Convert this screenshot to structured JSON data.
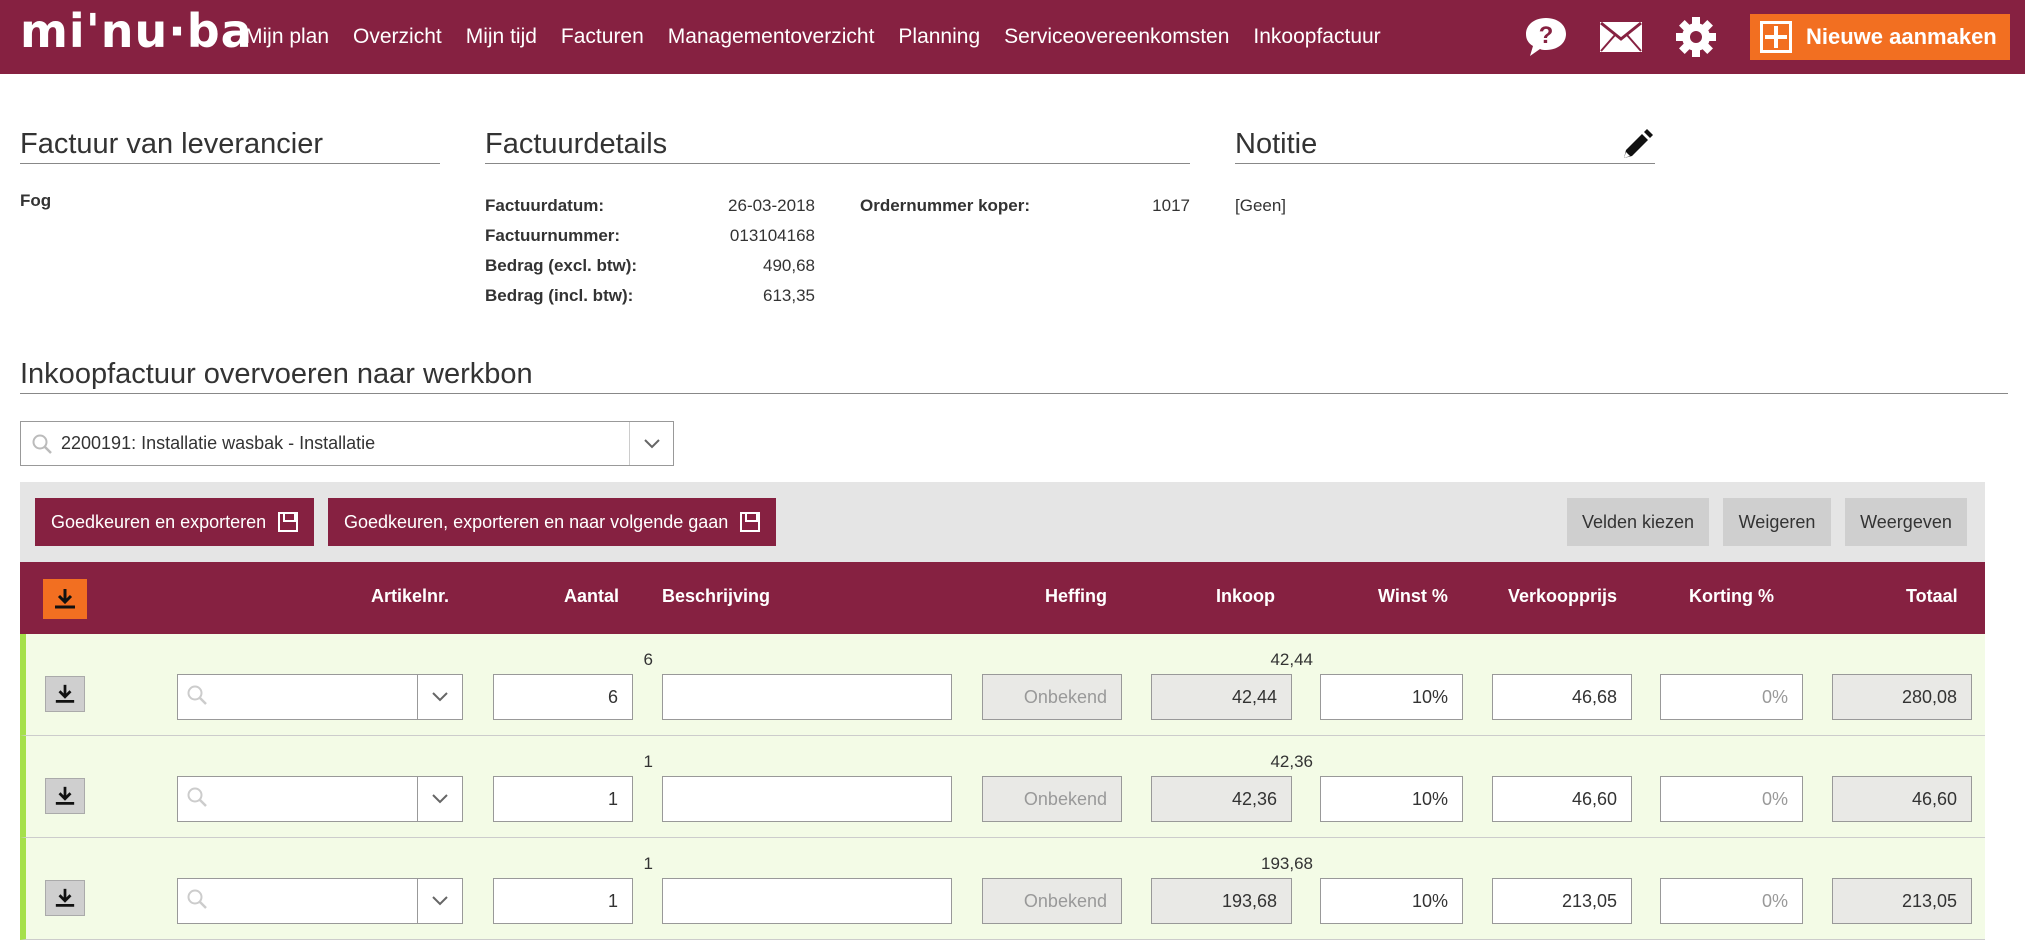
{
  "app": {
    "logo": "mi'nu·ba"
  },
  "nav": {
    "items": [
      "Mijn plan",
      "Overzicht",
      "Mijn tijd",
      "Facturen",
      "Managementoverzicht",
      "Planning",
      "Serviceovereenkomsten",
      "Inkoopfactuur"
    ]
  },
  "header": {
    "new_button_label": "Nieuwe aanmaken"
  },
  "supplier": {
    "title": "Factuur van leverancier",
    "name": "Fog"
  },
  "details": {
    "title": "Factuurdetails",
    "fields": [
      {
        "label": "Factuurdatum:",
        "value": "26-03-2018"
      },
      {
        "label": "Factuurnummer:",
        "value": "013104168"
      },
      {
        "label": "Bedrag (excl. btw):",
        "value": "490,68"
      },
      {
        "label": "Bedrag (incl. btw):",
        "value": "613,35"
      }
    ],
    "order_label": "Ordernummer koper:",
    "order_value": "1017"
  },
  "note": {
    "title": "Notitie",
    "value": "[Geen]"
  },
  "transfer": {
    "title": "Inkoopfactuur overvoeren naar werkbon",
    "workorder_value": "2200191: Installatie wasbak - Installatie"
  },
  "actions": {
    "approve_export": "Goedkeuren en exporteren",
    "approve_export_next": "Goedkeuren, exporteren en naar volgende gaan",
    "choose_fields": "Velden kiezen",
    "reject": "Weigeren",
    "display": "Weergeven"
  },
  "table": {
    "headers": {
      "article": "Artikelnr.",
      "quantity": "Aantal",
      "description": "Beschrijving",
      "levy": "Heffing",
      "purchase": "Inkoop",
      "margin": "Winst %",
      "sale_price": "Verkoopprijs",
      "discount": "Korting %",
      "total": "Totaal"
    },
    "rows": [
      {
        "qty_orig": "6",
        "purchase_orig": "42,44",
        "quantity": "6",
        "description": "",
        "levy": "Onbekend",
        "purchase": "42,44",
        "margin": "10%",
        "sale_price": "46,68",
        "discount": "0%",
        "total": "280,08"
      },
      {
        "qty_orig": "1",
        "purchase_orig": "42,36",
        "quantity": "1",
        "description": "",
        "levy": "Onbekend",
        "purchase": "42,36",
        "margin": "10%",
        "sale_price": "46,60",
        "discount": "0%",
        "total": "46,60"
      },
      {
        "qty_orig": "1",
        "purchase_orig": "193,68",
        "quantity": "1",
        "description": "",
        "levy": "Onbekend",
        "purchase": "193,68",
        "margin": "10%",
        "sale_price": "213,05",
        "discount": "0%",
        "total": "213,05"
      }
    ]
  },
  "colors": {
    "brand": "#862141",
    "accent": "#f26f21",
    "row_bg": "#f3fbe6",
    "row_marker": "#a5e04a"
  },
  "icons": [
    "help-icon",
    "mail-icon",
    "gear-icon",
    "plus-icon",
    "pencil-icon",
    "search-icon",
    "chevron-down-icon",
    "download-icon",
    "save-icon"
  ]
}
